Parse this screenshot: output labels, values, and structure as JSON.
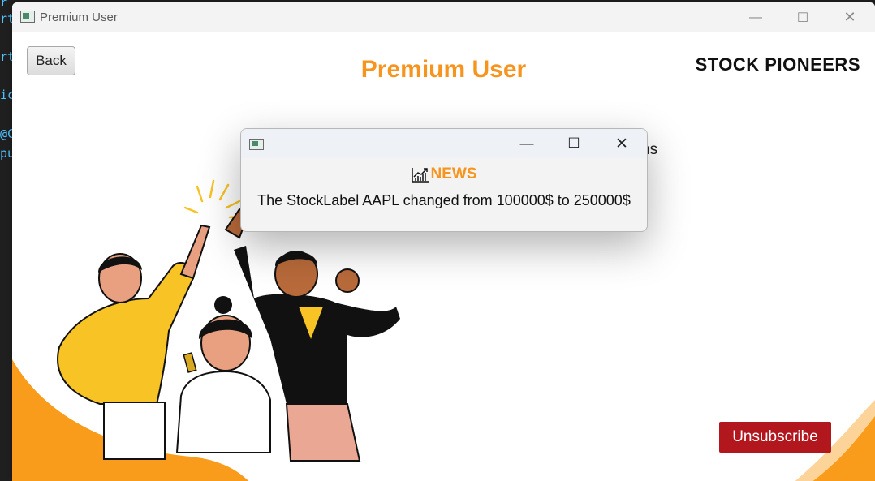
{
  "editor_bg": {
    "lines": [
      "r",
      "rt",
      "",
      "rt",
      "",
      "ic",
      "",
      "@C",
      "pu"
    ]
  },
  "window": {
    "title": "Premium User",
    "controls": {
      "minimize": "—",
      "maximize": "☐",
      "close": "✕"
    }
  },
  "header": {
    "back_label": "Back",
    "page_title": "Premium User",
    "brand": "STOCK PIONEERS"
  },
  "behind_popup_text": "ns",
  "footer": {
    "unsubscribe_label": "Unsubscribe"
  },
  "popup": {
    "controls": {
      "minimize": "—",
      "maximize": "☐",
      "close": "✕"
    },
    "heading": "NEWS",
    "message": "The StockLabel AAPL changed from 100000$ to 250000$",
    "heading_icon": "chart-icon"
  },
  "colors": {
    "accent": "#f7941d",
    "danger": "#b3171e",
    "brand_text": "#111111"
  }
}
